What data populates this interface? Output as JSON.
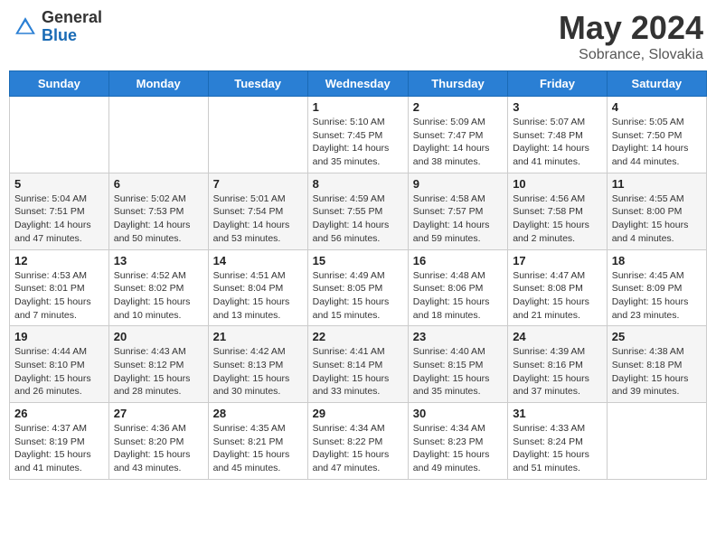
{
  "header": {
    "logo_general": "General",
    "logo_blue": "Blue",
    "title": "May 2024",
    "location": "Sobrance, Slovakia"
  },
  "weekdays": [
    "Sunday",
    "Monday",
    "Tuesday",
    "Wednesday",
    "Thursday",
    "Friday",
    "Saturday"
  ],
  "weeks": [
    [
      {
        "day": "",
        "sunrise": "",
        "sunset": "",
        "daylight": ""
      },
      {
        "day": "",
        "sunrise": "",
        "sunset": "",
        "daylight": ""
      },
      {
        "day": "",
        "sunrise": "",
        "sunset": "",
        "daylight": ""
      },
      {
        "day": "1",
        "sunrise": "Sunrise: 5:10 AM",
        "sunset": "Sunset: 7:45 PM",
        "daylight": "Daylight: 14 hours and 35 minutes."
      },
      {
        "day": "2",
        "sunrise": "Sunrise: 5:09 AM",
        "sunset": "Sunset: 7:47 PM",
        "daylight": "Daylight: 14 hours and 38 minutes."
      },
      {
        "day": "3",
        "sunrise": "Sunrise: 5:07 AM",
        "sunset": "Sunset: 7:48 PM",
        "daylight": "Daylight: 14 hours and 41 minutes."
      },
      {
        "day": "4",
        "sunrise": "Sunrise: 5:05 AM",
        "sunset": "Sunset: 7:50 PM",
        "daylight": "Daylight: 14 hours and 44 minutes."
      }
    ],
    [
      {
        "day": "5",
        "sunrise": "Sunrise: 5:04 AM",
        "sunset": "Sunset: 7:51 PM",
        "daylight": "Daylight: 14 hours and 47 minutes."
      },
      {
        "day": "6",
        "sunrise": "Sunrise: 5:02 AM",
        "sunset": "Sunset: 7:53 PM",
        "daylight": "Daylight: 14 hours and 50 minutes."
      },
      {
        "day": "7",
        "sunrise": "Sunrise: 5:01 AM",
        "sunset": "Sunset: 7:54 PM",
        "daylight": "Daylight: 14 hours and 53 minutes."
      },
      {
        "day": "8",
        "sunrise": "Sunrise: 4:59 AM",
        "sunset": "Sunset: 7:55 PM",
        "daylight": "Daylight: 14 hours and 56 minutes."
      },
      {
        "day": "9",
        "sunrise": "Sunrise: 4:58 AM",
        "sunset": "Sunset: 7:57 PM",
        "daylight": "Daylight: 14 hours and 59 minutes."
      },
      {
        "day": "10",
        "sunrise": "Sunrise: 4:56 AM",
        "sunset": "Sunset: 7:58 PM",
        "daylight": "Daylight: 15 hours and 2 minutes."
      },
      {
        "day": "11",
        "sunrise": "Sunrise: 4:55 AM",
        "sunset": "Sunset: 8:00 PM",
        "daylight": "Daylight: 15 hours and 4 minutes."
      }
    ],
    [
      {
        "day": "12",
        "sunrise": "Sunrise: 4:53 AM",
        "sunset": "Sunset: 8:01 PM",
        "daylight": "Daylight: 15 hours and 7 minutes."
      },
      {
        "day": "13",
        "sunrise": "Sunrise: 4:52 AM",
        "sunset": "Sunset: 8:02 PM",
        "daylight": "Daylight: 15 hours and 10 minutes."
      },
      {
        "day": "14",
        "sunrise": "Sunrise: 4:51 AM",
        "sunset": "Sunset: 8:04 PM",
        "daylight": "Daylight: 15 hours and 13 minutes."
      },
      {
        "day": "15",
        "sunrise": "Sunrise: 4:49 AM",
        "sunset": "Sunset: 8:05 PM",
        "daylight": "Daylight: 15 hours and 15 minutes."
      },
      {
        "day": "16",
        "sunrise": "Sunrise: 4:48 AM",
        "sunset": "Sunset: 8:06 PM",
        "daylight": "Daylight: 15 hours and 18 minutes."
      },
      {
        "day": "17",
        "sunrise": "Sunrise: 4:47 AM",
        "sunset": "Sunset: 8:08 PM",
        "daylight": "Daylight: 15 hours and 21 minutes."
      },
      {
        "day": "18",
        "sunrise": "Sunrise: 4:45 AM",
        "sunset": "Sunset: 8:09 PM",
        "daylight": "Daylight: 15 hours and 23 minutes."
      }
    ],
    [
      {
        "day": "19",
        "sunrise": "Sunrise: 4:44 AM",
        "sunset": "Sunset: 8:10 PM",
        "daylight": "Daylight: 15 hours and 26 minutes."
      },
      {
        "day": "20",
        "sunrise": "Sunrise: 4:43 AM",
        "sunset": "Sunset: 8:12 PM",
        "daylight": "Daylight: 15 hours and 28 minutes."
      },
      {
        "day": "21",
        "sunrise": "Sunrise: 4:42 AM",
        "sunset": "Sunset: 8:13 PM",
        "daylight": "Daylight: 15 hours and 30 minutes."
      },
      {
        "day": "22",
        "sunrise": "Sunrise: 4:41 AM",
        "sunset": "Sunset: 8:14 PM",
        "daylight": "Daylight: 15 hours and 33 minutes."
      },
      {
        "day": "23",
        "sunrise": "Sunrise: 4:40 AM",
        "sunset": "Sunset: 8:15 PM",
        "daylight": "Daylight: 15 hours and 35 minutes."
      },
      {
        "day": "24",
        "sunrise": "Sunrise: 4:39 AM",
        "sunset": "Sunset: 8:16 PM",
        "daylight": "Daylight: 15 hours and 37 minutes."
      },
      {
        "day": "25",
        "sunrise": "Sunrise: 4:38 AM",
        "sunset": "Sunset: 8:18 PM",
        "daylight": "Daylight: 15 hours and 39 minutes."
      }
    ],
    [
      {
        "day": "26",
        "sunrise": "Sunrise: 4:37 AM",
        "sunset": "Sunset: 8:19 PM",
        "daylight": "Daylight: 15 hours and 41 minutes."
      },
      {
        "day": "27",
        "sunrise": "Sunrise: 4:36 AM",
        "sunset": "Sunset: 8:20 PM",
        "daylight": "Daylight: 15 hours and 43 minutes."
      },
      {
        "day": "28",
        "sunrise": "Sunrise: 4:35 AM",
        "sunset": "Sunset: 8:21 PM",
        "daylight": "Daylight: 15 hours and 45 minutes."
      },
      {
        "day": "29",
        "sunrise": "Sunrise: 4:34 AM",
        "sunset": "Sunset: 8:22 PM",
        "daylight": "Daylight: 15 hours and 47 minutes."
      },
      {
        "day": "30",
        "sunrise": "Sunrise: 4:34 AM",
        "sunset": "Sunset: 8:23 PM",
        "daylight": "Daylight: 15 hours and 49 minutes."
      },
      {
        "day": "31",
        "sunrise": "Sunrise: 4:33 AM",
        "sunset": "Sunset: 8:24 PM",
        "daylight": "Daylight: 15 hours and 51 minutes."
      },
      {
        "day": "",
        "sunrise": "",
        "sunset": "",
        "daylight": ""
      }
    ]
  ]
}
